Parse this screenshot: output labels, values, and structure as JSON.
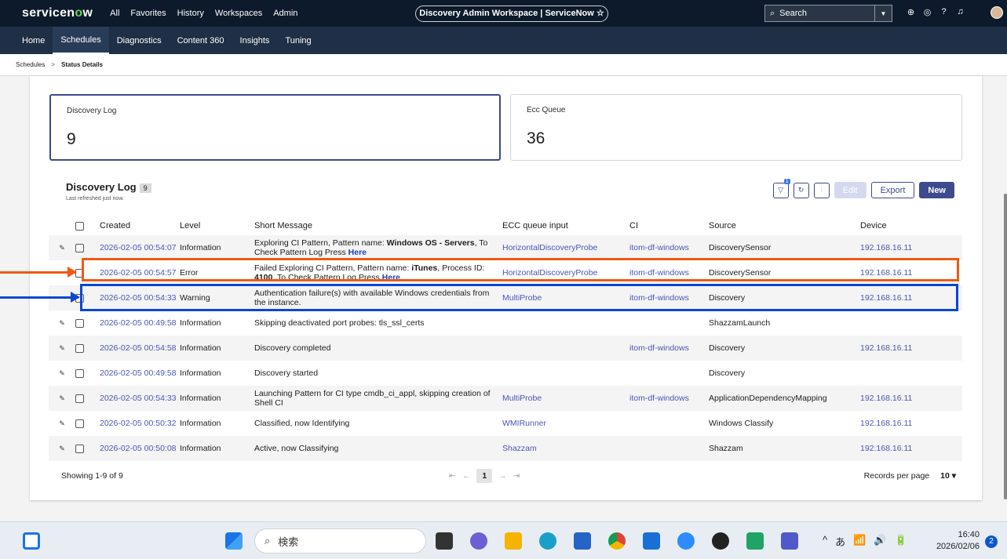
{
  "topbar": {
    "logo_a": "servicen",
    "logo_o": "o",
    "logo_b": "w",
    "nav": [
      "All",
      "Favorites",
      "History",
      "Workspaces",
      "Admin"
    ],
    "workspace_title": "Discovery Admin Workspace | ServiceNow ☆",
    "search_placeholder": "Search"
  },
  "subnav": [
    "Home",
    "Schedules",
    "Diagnostics",
    "Content 360",
    "Insights",
    "Tuning"
  ],
  "breadcrumb": {
    "parent": "Schedules",
    "current": "Status Details"
  },
  "cards": [
    {
      "title": "Discovery Log",
      "value": "9"
    },
    {
      "title": "Ecc Queue",
      "value": "36"
    }
  ],
  "list": {
    "title": "Discovery Log",
    "count": "9",
    "subtitle": "Last refreshed just now.",
    "filter_badge": "1",
    "buttons": {
      "edit": "Edit",
      "export": "Export",
      "new": "New"
    },
    "headers": {
      "created": "Created",
      "level": "Level",
      "message": "Short Message",
      "ecc": "ECC queue input",
      "ci": "CI",
      "source": "Source",
      "device": "Device"
    },
    "rows": [
      {
        "created": "2026-02-05 00:54:07",
        "level": "Information",
        "msg_a": "Exploring CI Pattern, Pattern name: ",
        "msg_b": "Windows OS - Servers",
        "msg_c": ", To Check Pattern Log Press ",
        "msg_link": "Here",
        "ecc": "HorizontalDiscoveryProbe",
        "ci": "itom-df-windows",
        "source": "DiscoverySensor",
        "device": "192.168.16.11"
      },
      {
        "created": "2026-02-05 00:54:57",
        "level": "Error",
        "msg_a": "Failed Exploring CI Pattern, Pattern name: ",
        "msg_b": "iTunes",
        "msg_c": ", Process ID: ",
        "msg_d": "4100",
        "msg_e": ", To Check Pattern Log Press ",
        "msg_link": "Here",
        "ecc": "HorizontalDiscoveryProbe",
        "ci": "itom-df-windows",
        "source": "DiscoverySensor",
        "device": "192.168.16.11"
      },
      {
        "created": "2026-02-05 00:54:33",
        "level": "Warning",
        "msg": "Authentication failure(s) with available Windows credentials from the instance.",
        "ecc": "MultiProbe",
        "ci": "itom-df-windows",
        "source": "Discovery",
        "device": "192.168.16.11"
      },
      {
        "created": "2026-02-05 00:49:58",
        "level": "Information",
        "msg": "Skipping deactivated port probes: tls_ssl_certs",
        "ecc": "",
        "ci": "",
        "source": "ShazzamLaunch",
        "device": ""
      },
      {
        "created": "2026-02-05 00:54:58",
        "level": "Information",
        "msg": "Discovery completed",
        "ecc": "",
        "ci": "itom-df-windows",
        "source": "Discovery",
        "device": "192.168.16.11"
      },
      {
        "created": "2026-02-05 00:49:58",
        "level": "Information",
        "msg": "Discovery started",
        "ecc": "",
        "ci": "",
        "source": "Discovery",
        "device": ""
      },
      {
        "created": "2026-02-05 00:54:33",
        "level": "Information",
        "msg": "Launching Pattern for CI type cmdb_ci_appl, skipping creation of Shell CI",
        "ecc": "MultiProbe",
        "ci": "itom-df-windows",
        "source": "ApplicationDependencyMapping",
        "device": "192.168.16.11"
      },
      {
        "created": "2026-02-05 00:50:32",
        "level": "Information",
        "msg": "Classified, now Identifying",
        "ecc": "WMIRunner",
        "ci": "",
        "source": "Windows Classify",
        "device": "192.168.16.11"
      },
      {
        "created": "2026-02-05 00:50:08",
        "level": "Information",
        "msg": "Active, now Classifying",
        "ecc": "Shazzam",
        "ci": "",
        "source": "Shazzam",
        "device": "192.168.16.11"
      }
    ],
    "showing": "Showing 1-9 of 9",
    "page": "1",
    "records_label": "Records per page",
    "records_value": "10 ▾"
  },
  "taskbar": {
    "search_label": "検索",
    "tray": [
      "^",
      "あ",
      "📶",
      "🔊",
      "🔋"
    ],
    "time": "16:40",
    "date": "2026/02/06",
    "notifications": "2"
  }
}
